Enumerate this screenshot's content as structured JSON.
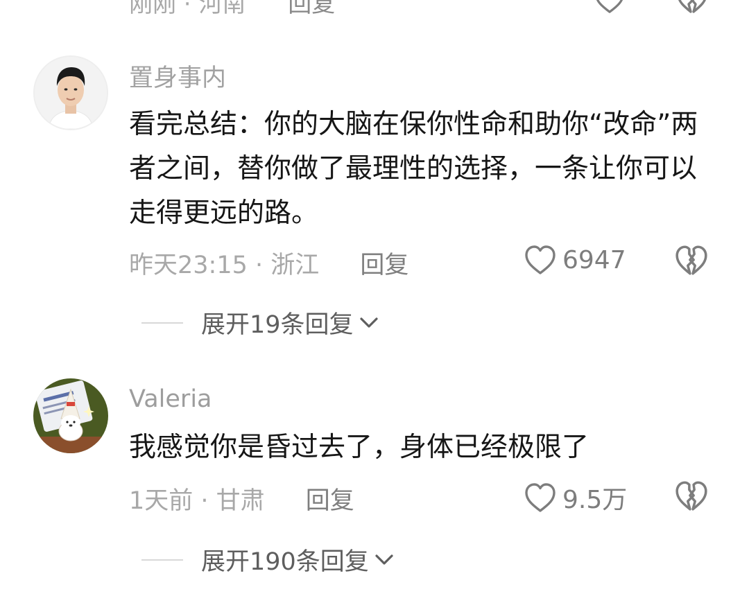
{
  "top_comment": {
    "meta": "刚刚 · 河南",
    "reply_label": "回复"
  },
  "comments": [
    {
      "username": "置身事内",
      "avatar_icon": "avatar-man-photo",
      "content": "看完总结：你的大脑在保你性命和助你“改命”两者之间，替你做了最理性的选择，一条让你可以走得更远的路。",
      "meta": "昨天23:15 · 浙江",
      "reply_label": "回复",
      "likes": "6947",
      "expand_label": "展开19条回复"
    },
    {
      "username": "Valeria",
      "avatar_icon": "avatar-cartoon-dog",
      "content": "我感觉你是昏过去了，身体已经极限了",
      "meta": "1天前 · 甘肃",
      "reply_label": "回复",
      "likes": "9.5万",
      "expand_label": "展开190条回复"
    }
  ],
  "icons": {
    "like": "heart-outline-icon",
    "dislike": "broken-heart-icon",
    "expand": "chevron-down-icon"
  },
  "colors": {
    "text_primary": "#161616",
    "text_secondary": "#a8a8a8",
    "reply": "#7f7f7f",
    "icon": "#808080"
  }
}
